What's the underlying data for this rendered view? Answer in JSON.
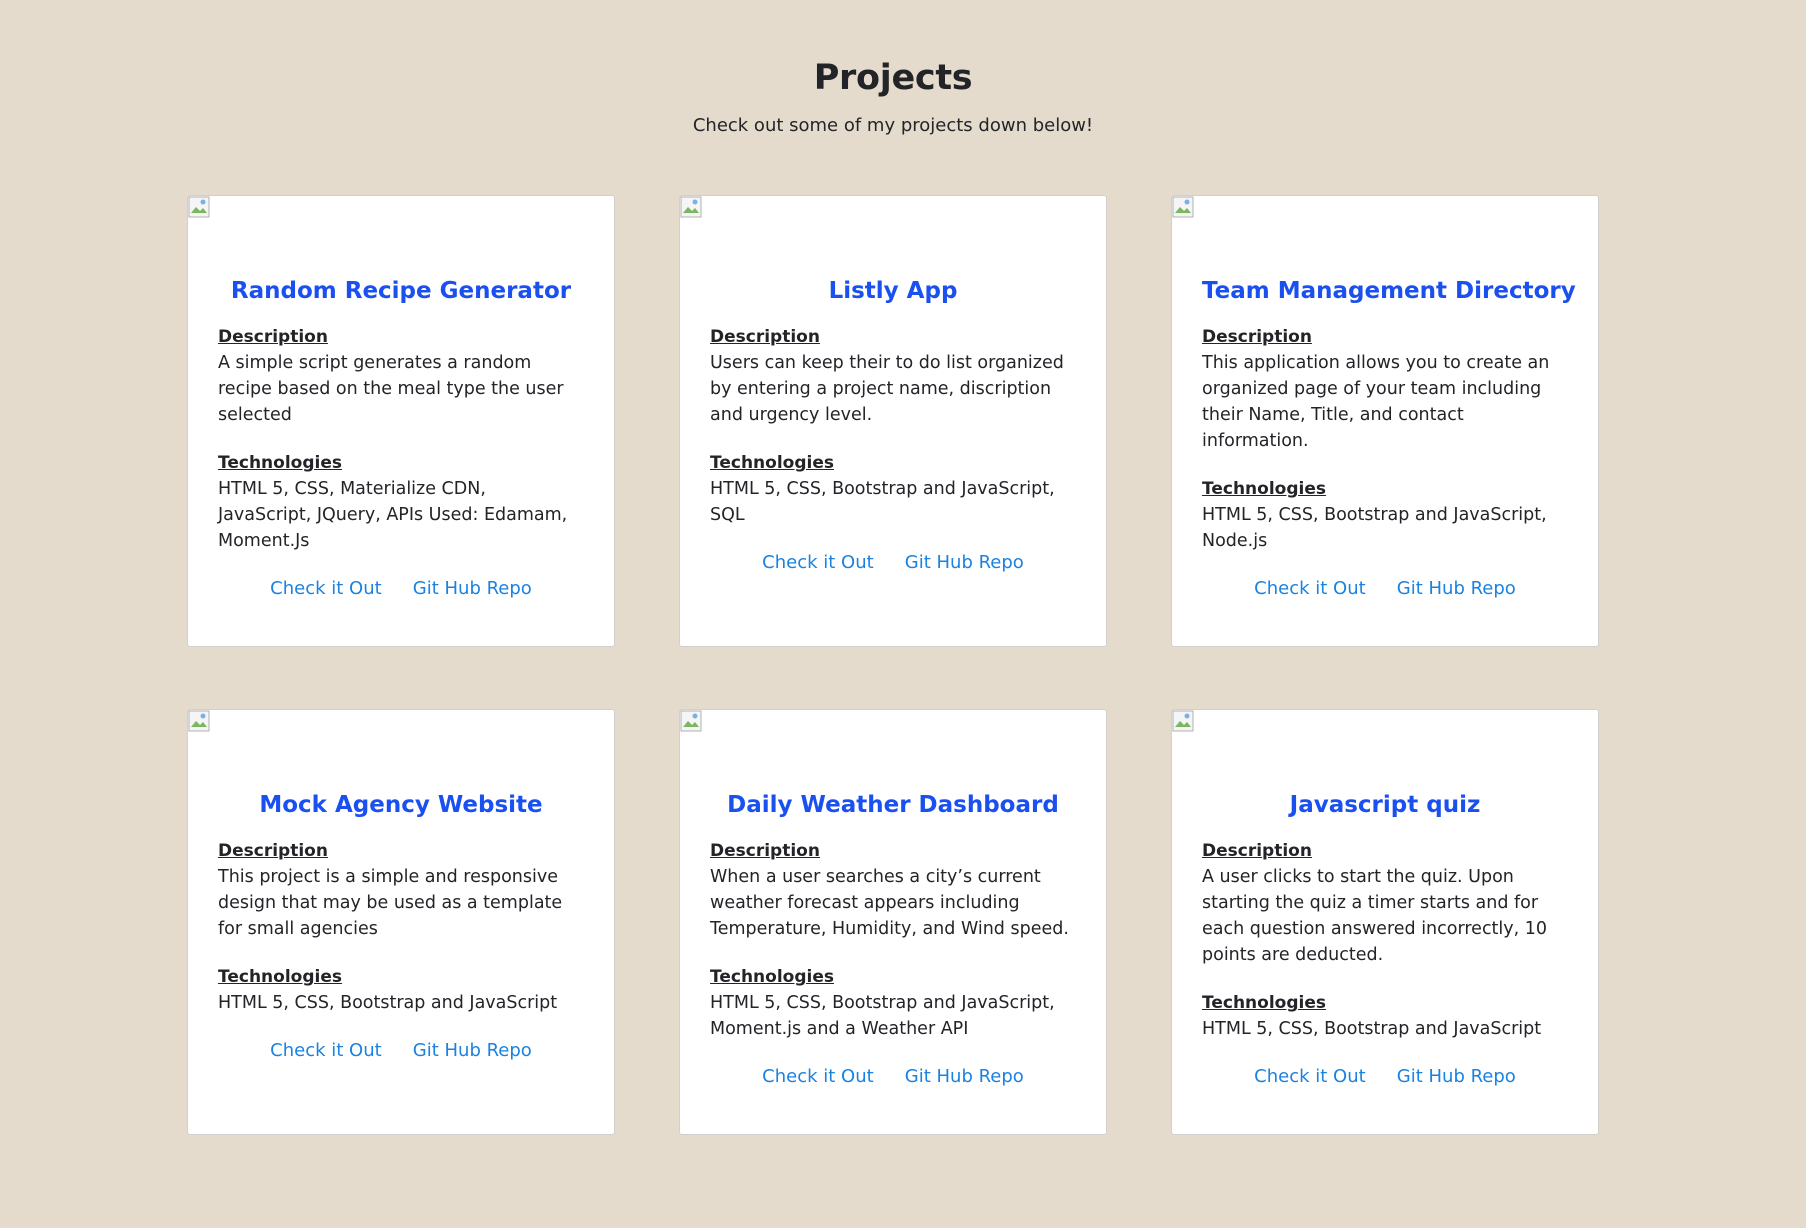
{
  "section": {
    "title": "Projects",
    "subtitle": "Check out some of my projects down below!"
  },
  "labels": {
    "description": "Description",
    "technologies": "Technologies"
  },
  "projects": [
    {
      "title": "Random Recipe Generator",
      "description": "A simple script generates a random recipe based on the meal type the user selected",
      "technologies": "HTML 5, CSS, Materialize CDN, JavaScript, JQuery, APIs Used: Edamam, Moment.Js",
      "link_live": "Check it Out",
      "link_repo": "Git Hub Repo"
    },
    {
      "title": "Listly App",
      "description": "Users can keep their to do list organized by entering a project name, discription and urgency level.",
      "technologies": "HTML 5, CSS, Bootstrap and JavaScript, SQL",
      "link_live": "Check it Out",
      "link_repo": "Git Hub Repo"
    },
    {
      "title": "Team Management Directory",
      "description": "This application allows you to create an organized page of your team including their Name, Title, and contact information.",
      "technologies": "HTML 5, CSS, Bootstrap and JavaScript, Node.js",
      "link_live": "Check it Out",
      "link_repo": "Git Hub Repo"
    },
    {
      "title": "Mock Agency Website",
      "description": "This project is a simple and responsive design that may be used as a template for small agencies",
      "technologies": "HTML 5, CSS, Bootstrap and JavaScript",
      "link_live": "Check it Out",
      "link_repo": "Git Hub Repo"
    },
    {
      "title": "Daily Weather Dashboard",
      "description": "When a user searches a city’s current weather forecast appears including Temperature, Humidity, and Wind speed.",
      "technologies": "HTML 5, CSS, Bootstrap and JavaScript, Moment.js and a Weather API",
      "link_live": "Check it Out",
      "link_repo": "Git Hub Repo"
    },
    {
      "title": "Javascript quiz",
      "description": "A user clicks to start the quiz. Upon starting the quiz a timer starts and for each question answered incorrectly, 10 points are deducted.",
      "technologies": "HTML 5, CSS, Bootstrap and JavaScript",
      "link_live": "Check it Out",
      "link_repo": "Git Hub Repo"
    }
  ],
  "colors": {
    "background": "#e5dbcd",
    "title": "#1a4ff0",
    "link": "#1a82e0"
  },
  "icons": {
    "thumbnail": "broken-image-icon"
  }
}
